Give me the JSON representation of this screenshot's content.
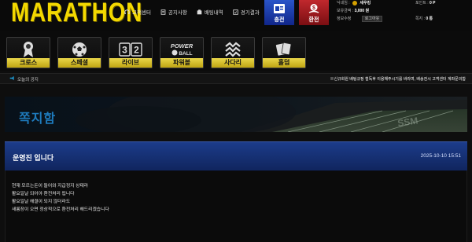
{
  "header": {
    "logo": "MARATHON",
    "links": [
      {
        "label": "고객센터",
        "icon": "headset-icon"
      },
      {
        "label": "공지사항",
        "icon": "notice-icon"
      },
      {
        "label": "배팅내역",
        "icon": "betting-history-icon"
      },
      {
        "label": "경기결과",
        "icon": "results-icon"
      }
    ],
    "deposit": {
      "label": "충전",
      "icon": "deposit-icon"
    },
    "withdraw": {
      "label": "환전",
      "icon": "withdraw-icon"
    },
    "user": {
      "nickname_label": "닉네임 :",
      "nickname": "세우킹",
      "money_label": "보유금액 :",
      "money": "3,000 원",
      "info_label": "정보수정",
      "logout_label": "로그아웃",
      "point_label": "포인트 :",
      "point": "0 P",
      "note_label": "쪽지 :",
      "note": "0 통"
    }
  },
  "nav": [
    {
      "label": "크로스",
      "icon": "award-ribbon-icon"
    },
    {
      "label": "스페셜",
      "icon": "soccer-ball-icon"
    },
    {
      "label": "라이브",
      "icon": "live-score-icon",
      "icon_text": "3|2"
    },
    {
      "label": "파워볼",
      "icon": "powerball-icon",
      "icon_text": "POWER BALL"
    },
    {
      "label": "사다리",
      "icon": "ladder-icon"
    },
    {
      "label": "홀덤",
      "icon": "cards-icon"
    }
  ],
  "notice": {
    "label": "오늘의 공지",
    "text": "※신규회원 배팅규정 철독후 이용해주시기를 바라며, 배송전시 고객센터 계좌문의함"
  },
  "banner": {
    "title": "쪽지함"
  },
  "message": {
    "title": "운영진 입니다",
    "date": "2025-10-10 15:51",
    "lines": [
      "현재 모르는돈이 들어와 지급정지 상태라",
      "활요일날 되어야 환전처리 됩니다",
      "활요일날 해결이 되지 않더라도",
      "새롱장이 오면 정상적으로 환전처리 해드리겠습니다"
    ]
  },
  "colors": {
    "accent_yellow": "#f3d800",
    "deposit_blue": "#1a3fb0",
    "withdraw_red": "#a01a1f",
    "panel_blue": "#1c3c8a",
    "banner_blue": "#1e7bbd"
  }
}
